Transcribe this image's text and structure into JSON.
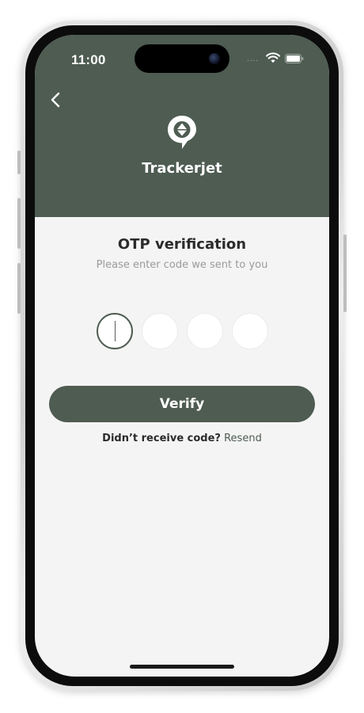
{
  "status_bar": {
    "time": "11:00",
    "signal": "....",
    "wifi_icon": "wifi-icon",
    "battery_icon": "battery-icon"
  },
  "header": {
    "back_icon": "chevron-left-icon",
    "logo_icon": "location-pin-icon",
    "brand_name": "Trackerjet",
    "background_color": "#4e5c52"
  },
  "otp": {
    "title": "OTP verification",
    "subtitle": "Please enter code we sent to you",
    "digits": [
      "",
      "",
      "",
      ""
    ],
    "active_index": 0
  },
  "actions": {
    "verify_label": "Verify",
    "resend_prompt": "Didn’t receive code?",
    "resend_label": "Resend"
  },
  "colors": {
    "accent": "#4e5c52",
    "background": "#f4f4f4"
  }
}
